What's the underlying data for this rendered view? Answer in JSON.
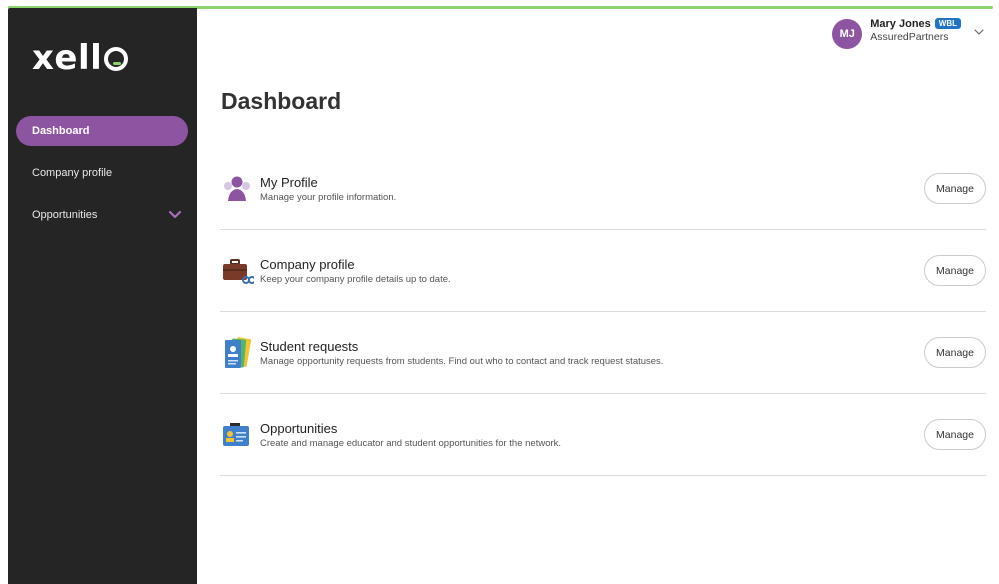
{
  "app": {
    "logo_text": "xell"
  },
  "sidebar": {
    "items": [
      {
        "label": "Dashboard"
      },
      {
        "label": "Company profile"
      },
      {
        "label": "Opportunities"
      }
    ]
  },
  "user": {
    "initials": "MJ",
    "name": "Mary Jones",
    "badge": "WBL",
    "org": "AssuredPartners"
  },
  "main": {
    "title": "Dashboard",
    "cards": [
      {
        "title": "My Profile",
        "desc": "Manage your profile information.",
        "button": "Manage",
        "icon": "profile-icon"
      },
      {
        "title": "Company profile",
        "desc": "Keep your company profile details up to date.",
        "button": "Manage",
        "icon": "briefcase-icon"
      },
      {
        "title": "Student requests",
        "desc": "Manage opportunity requests from students. Find out who to contact and track request statuses.",
        "button": "Manage",
        "icon": "student-requests-icon"
      },
      {
        "title": "Opportunities",
        "desc": "Create and manage educator and student opportunities for the network.",
        "button": "Manage",
        "icon": "opportunities-icon"
      }
    ]
  },
  "colors": {
    "accent": "#8c54a1",
    "brand_green": "#8bd36a",
    "badge_blue": "#1f74c7",
    "sidebar_bg": "#252525"
  }
}
